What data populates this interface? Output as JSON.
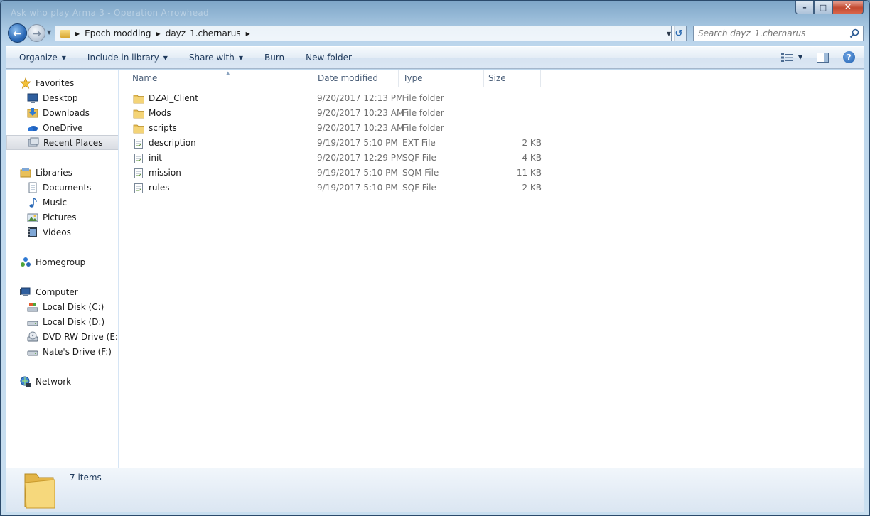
{
  "window": {
    "ghost_title": "Ask who play Arma 3 - Operation Arrowhead",
    "controls": {
      "minimize": "–",
      "maximize": "□",
      "close": "✕"
    }
  },
  "address": {
    "crumbs": [
      "Epoch modding",
      "dayz_1.chernarus"
    ],
    "search_placeholder": "Search dayz_1.chernarus"
  },
  "toolbar": {
    "organize": "Organize",
    "include_in_library": "Include in library",
    "share_with": "Share with",
    "burn": "Burn",
    "new_folder": "New folder"
  },
  "nav": {
    "favorites": {
      "label": "Favorites",
      "items": [
        "Desktop",
        "Downloads",
        "OneDrive",
        "Recent Places"
      ]
    },
    "libraries": {
      "label": "Libraries",
      "items": [
        "Documents",
        "Music",
        "Pictures",
        "Videos"
      ]
    },
    "homegroup": {
      "label": "Homegroup"
    },
    "computer": {
      "label": "Computer",
      "items": [
        "Local Disk (C:)",
        "Local Disk (D:)",
        "DVD RW Drive (E:) C",
        "Nate's Drive (F:)"
      ]
    },
    "network": {
      "label": "Network"
    },
    "selected": "Recent Places"
  },
  "columns": {
    "name": "Name",
    "date": "Date modified",
    "type": "Type",
    "size": "Size"
  },
  "files": [
    {
      "name": "DZAI_Client",
      "date": "9/20/2017 12:13 PM",
      "type": "File folder",
      "size": "",
      "kind": "folder"
    },
    {
      "name": "Mods",
      "date": "9/20/2017 10:23 AM",
      "type": "File folder",
      "size": "",
      "kind": "folder"
    },
    {
      "name": "scripts",
      "date": "9/20/2017 10:23 AM",
      "type": "File folder",
      "size": "",
      "kind": "folder"
    },
    {
      "name": "description",
      "date": "9/19/2017 5:10 PM",
      "type": "EXT File",
      "size": "2 KB",
      "kind": "file"
    },
    {
      "name": "init",
      "date": "9/20/2017 12:29 PM",
      "type": "SQF File",
      "size": "4 KB",
      "kind": "file"
    },
    {
      "name": "mission",
      "date": "9/19/2017 5:10 PM",
      "type": "SQM File",
      "size": "11 KB",
      "kind": "file"
    },
    {
      "name": "rules",
      "date": "9/19/2017 5:10 PM",
      "type": "SQF File",
      "size": "2 KB",
      "kind": "file"
    }
  ],
  "status": {
    "item_count": "7 items"
  },
  "colors": {
    "accent": "#1e395b",
    "folder": "#e8c05a",
    "selection": "#d9dde3"
  }
}
